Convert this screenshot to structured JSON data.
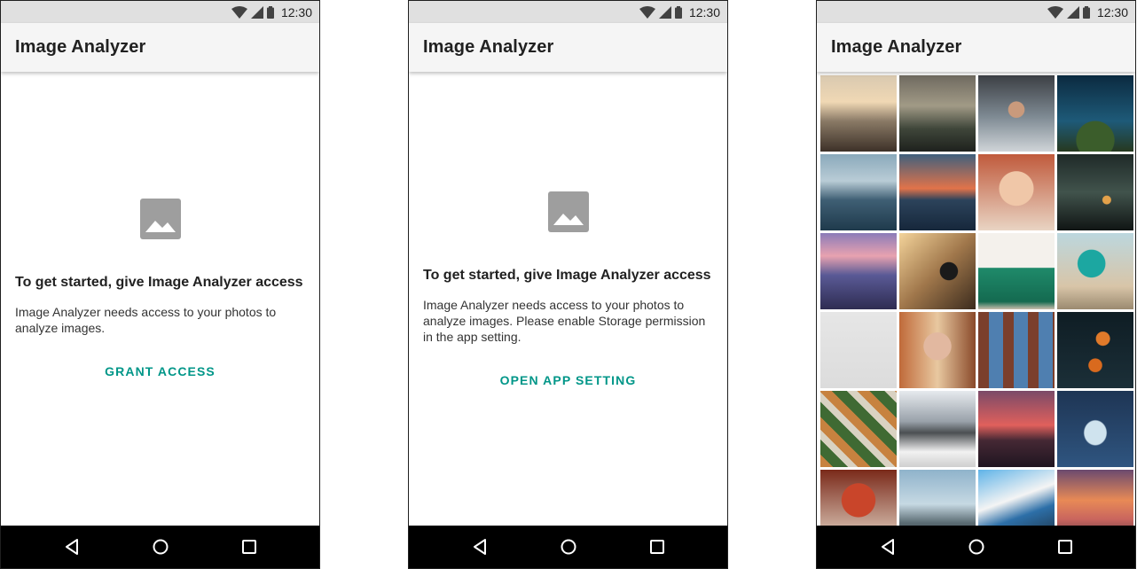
{
  "status_bar": {
    "time": "12:30"
  },
  "app": {
    "title": "Image Analyzer"
  },
  "screen_1": {
    "heading": "To get started, give Image Analyzer access",
    "body": "Image Analyzer needs access to your photos to analyze images.",
    "button_label": "GRANT ACCESS"
  },
  "screen_2": {
    "heading": "To get started, give Image Analyzer access",
    "body": "Image Analyzer needs access to your photos to analyze images. Please enable Storage permission in the app setting.",
    "button_label": "OPEN APP SETTING"
  },
  "screen_3": {
    "photos": [
      "dock-at-sunset",
      "misty-road-valley",
      "woman-in-hood",
      "starry-sky-trees",
      "cloudy-sea",
      "sunset-over-water",
      "smiling-redhead-woman",
      "forest-waterfall",
      "purple-rocky-shore",
      "microphone-studio",
      "green-cabinet-vase",
      "woman-in-teal-dress",
      "foggy-white-blank",
      "young-man-portrait",
      "brick-building-windows",
      "orange-leaves-night",
      "aerial-neighborhood",
      "snowy-mountains-lake",
      "red-sunset-hills",
      "statue-blue-light",
      "red-lantern-ceiling",
      "cloudy-coast",
      "blue-panels-abstract",
      "orange-cloud-sky"
    ]
  },
  "colors": {
    "accent": "#009688",
    "status_bar": "#e0e0e0",
    "app_bar": "#f5f5f5",
    "nav_bar": "#000000"
  },
  "icons": {
    "status": [
      "wifi-icon",
      "signal-icon",
      "battery-icon"
    ],
    "placeholder": "image-placeholder-icon",
    "nav": [
      "back-icon",
      "home-icon",
      "recents-icon"
    ]
  }
}
